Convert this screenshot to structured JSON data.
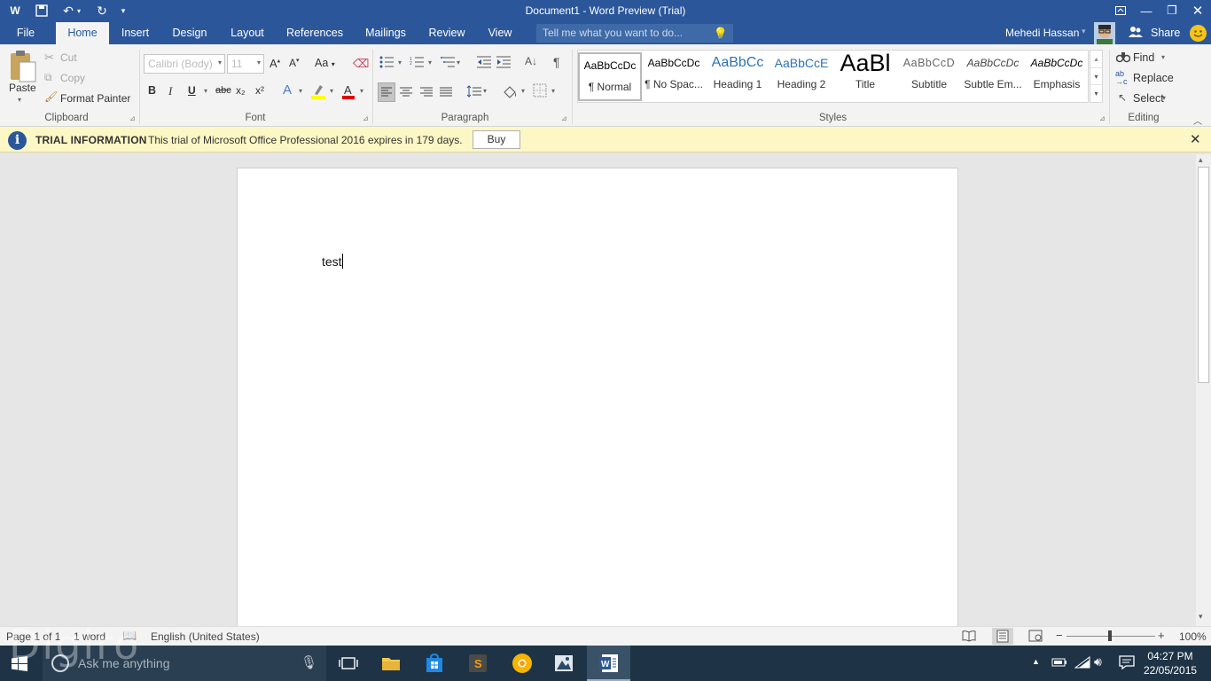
{
  "window": {
    "title": "Document1 - Word Preview (Trial)"
  },
  "tabs": [
    "File",
    "Home",
    "Insert",
    "Design",
    "Layout",
    "References",
    "Mailings",
    "Review",
    "View"
  ],
  "tell_me": {
    "placeholder": "Tell me what you want to do..."
  },
  "user": {
    "name": "Mehedi Hassan",
    "share": "Share"
  },
  "clipboard": {
    "paste": "Paste",
    "cut": "Cut",
    "copy": "Copy",
    "format_painter": "Format Painter",
    "label": "Clipboard"
  },
  "font": {
    "family": "Calibri (Body)",
    "size": "11",
    "label": "Font",
    "bold": "B",
    "italic": "I",
    "underline": "U",
    "strike": "abc",
    "sub": "x₂",
    "sup": "x²",
    "case": "Aa"
  },
  "paragraph": {
    "label": "Paragraph"
  },
  "styles": {
    "label": "Styles",
    "items": [
      {
        "preview": "AaBbCcDc",
        "name": "¶ Normal"
      },
      {
        "preview": "AaBbCcDc",
        "name": "¶ No Spac..."
      },
      {
        "preview": "AaBbCc",
        "name": "Heading 1"
      },
      {
        "preview": "AaBbCcE",
        "name": "Heading 2"
      },
      {
        "preview": "AaBl",
        "name": "Title"
      },
      {
        "preview": "AaBbCcD",
        "name": "Subtitle"
      },
      {
        "preview": "AaBbCcDc",
        "name": "Subtle Em..."
      },
      {
        "preview": "AaBbCcDc",
        "name": "Emphasis"
      }
    ]
  },
  "editing": {
    "find": "Find",
    "replace": "Replace",
    "select": "Select",
    "label": "Editing"
  },
  "trial": {
    "title": "TRIAL INFORMATION",
    "message": "This trial of Microsoft Office Professional 2016 expires in 179 days.",
    "buy": "Buy"
  },
  "document": {
    "text": "test"
  },
  "status": {
    "page": "Page 1 of 1",
    "words": "1 word",
    "language": "English (United States)",
    "zoom": "100%"
  },
  "taskbar": {
    "search_placeholder": "Ask me anything",
    "time": "04:27 PM",
    "date": "22/05/2015"
  },
  "watermark": "Digiro",
  "colors": {
    "accent": "#2b579a",
    "trial_bg": "#fcf7c4",
    "taskbar": "#1e3345"
  }
}
